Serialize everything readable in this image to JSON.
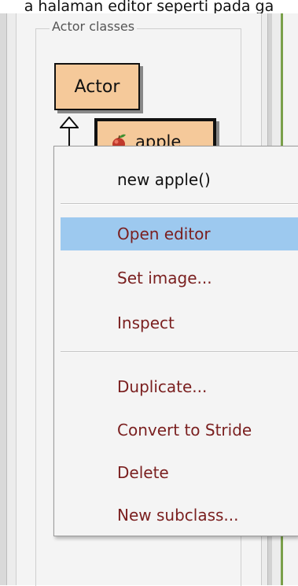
{
  "caption": "a halaman editor seperti pada ga",
  "group_label": "Actor classes",
  "classes": {
    "actor": "Actor",
    "apple": "apple"
  },
  "menu": {
    "new_instance": "new apple()",
    "open_editor": "Open editor",
    "set_image": "Set image...",
    "inspect": "Inspect",
    "duplicate": "Duplicate...",
    "convert": "Convert to Stride",
    "delete": "Delete",
    "new_subclass": "New subclass..."
  },
  "colors": {
    "class_fill": "#f5c99a",
    "menu_highlight": "#9dc9ef",
    "menu_text": "#7a1f1f"
  }
}
